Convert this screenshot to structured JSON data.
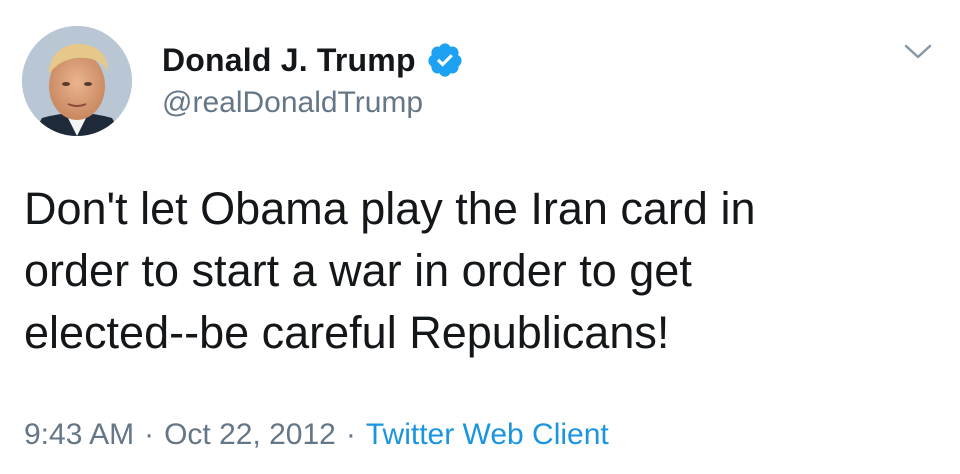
{
  "author": {
    "display_name": "Donald J. Trump",
    "handle": "@realDonaldTrump",
    "verified": true,
    "avatar_icon": "profile-photo"
  },
  "tweet": {
    "text": "Don't let Obama play the Iran card in\norder to start a war in order to get\nelected--be careful Republicans!",
    "time": "9:43 AM",
    "date": "Oct 22, 2012",
    "separator": "·",
    "source": "Twitter Web Client"
  },
  "icons": {
    "verified": "verified-badge-icon",
    "menu": "chevron-down-icon"
  },
  "colors": {
    "text": "#14171a",
    "secondary": "#657786",
    "link": "#1b95e0",
    "verified_badge": "#1da1f2"
  }
}
